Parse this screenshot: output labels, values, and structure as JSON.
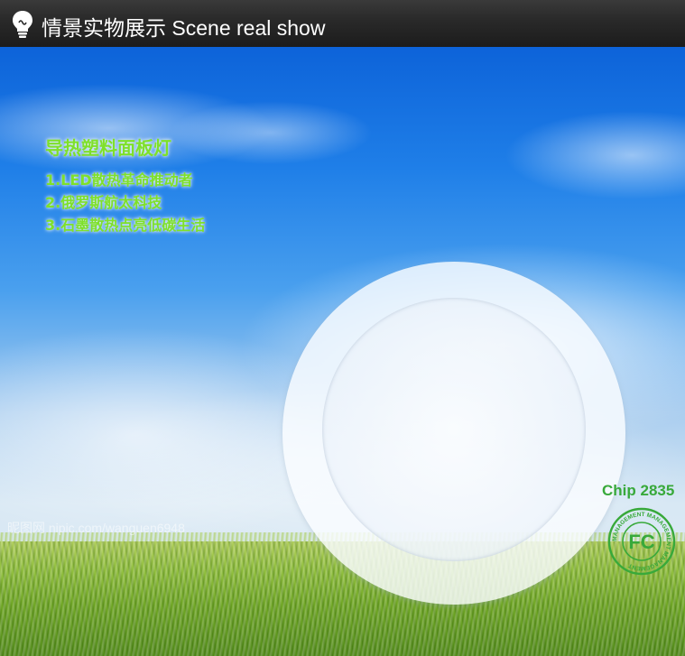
{
  "header": {
    "title": "情景实物展示 Scene real show",
    "icon": "lightbulb-icon"
  },
  "promo": {
    "heading": "导热塑料面板灯",
    "items": [
      "1.LED散热革命推动者",
      "2.俄罗斯航太科技",
      "3.石墨散热点亮低碳生活"
    ],
    "color": "#7ee02a"
  },
  "chip": {
    "label": "Chip 2835",
    "color": "#38a93a"
  },
  "certification": {
    "logo": "fc-mark-icon",
    "mark_text": "FC",
    "ring_text": "MANAGEMENT MANAGEMENT MANAGEMENT"
  },
  "watermark": {
    "text": "昵图网 nipic.com/wanguen6948"
  }
}
